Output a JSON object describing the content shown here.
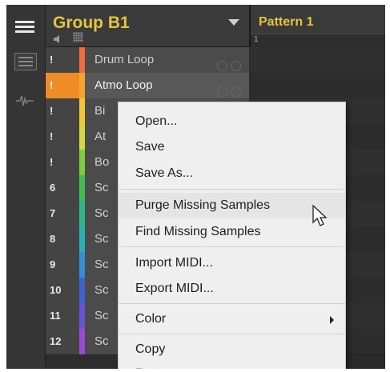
{
  "group": {
    "title": "Group B1"
  },
  "pattern": {
    "title": "Pattern 1",
    "ruler_mark": "1"
  },
  "sounds": [
    {
      "slot": "!",
      "name": "Drum Loop",
      "color": "#f26a3d"
    },
    {
      "slot": "!",
      "name": "Atmo Loop",
      "color": "#f5a32c"
    },
    {
      "slot": "!",
      "name": "Bi",
      "color": "#f2c630"
    },
    {
      "slot": "!",
      "name": "At",
      "color": "#d7d640"
    },
    {
      "slot": "!",
      "name": "Bo",
      "color": "#7ccf3a"
    },
    {
      "slot": "6",
      "name": "Sc",
      "color": "#3fbf52"
    },
    {
      "slot": "7",
      "name": "Sc",
      "color": "#2fb78b"
    },
    {
      "slot": "8",
      "name": "Sc",
      "color": "#27b3b6"
    },
    {
      "slot": "9",
      "name": "Sc",
      "color": "#2f90d8"
    },
    {
      "slot": "10",
      "name": "Sc",
      "color": "#3e62d6"
    },
    {
      "slot": "11",
      "name": "Sc",
      "color": "#6652d4"
    },
    {
      "slot": "12",
      "name": "Sc",
      "color": "#9b4ad4"
    }
  ],
  "context_menu": {
    "open": "Open...",
    "save": "Save",
    "save_as": "Save As...",
    "purge_missing": "Purge Missing Samples",
    "find_missing": "Find Missing Samples",
    "import_midi": "Import MIDI...",
    "export_midi": "Export MIDI...",
    "color": "Color",
    "copy": "Copy",
    "paste": "Paste"
  },
  "colors": {
    "accent_yellow": "#e3c63d",
    "selected_slot": "#f08c26"
  }
}
